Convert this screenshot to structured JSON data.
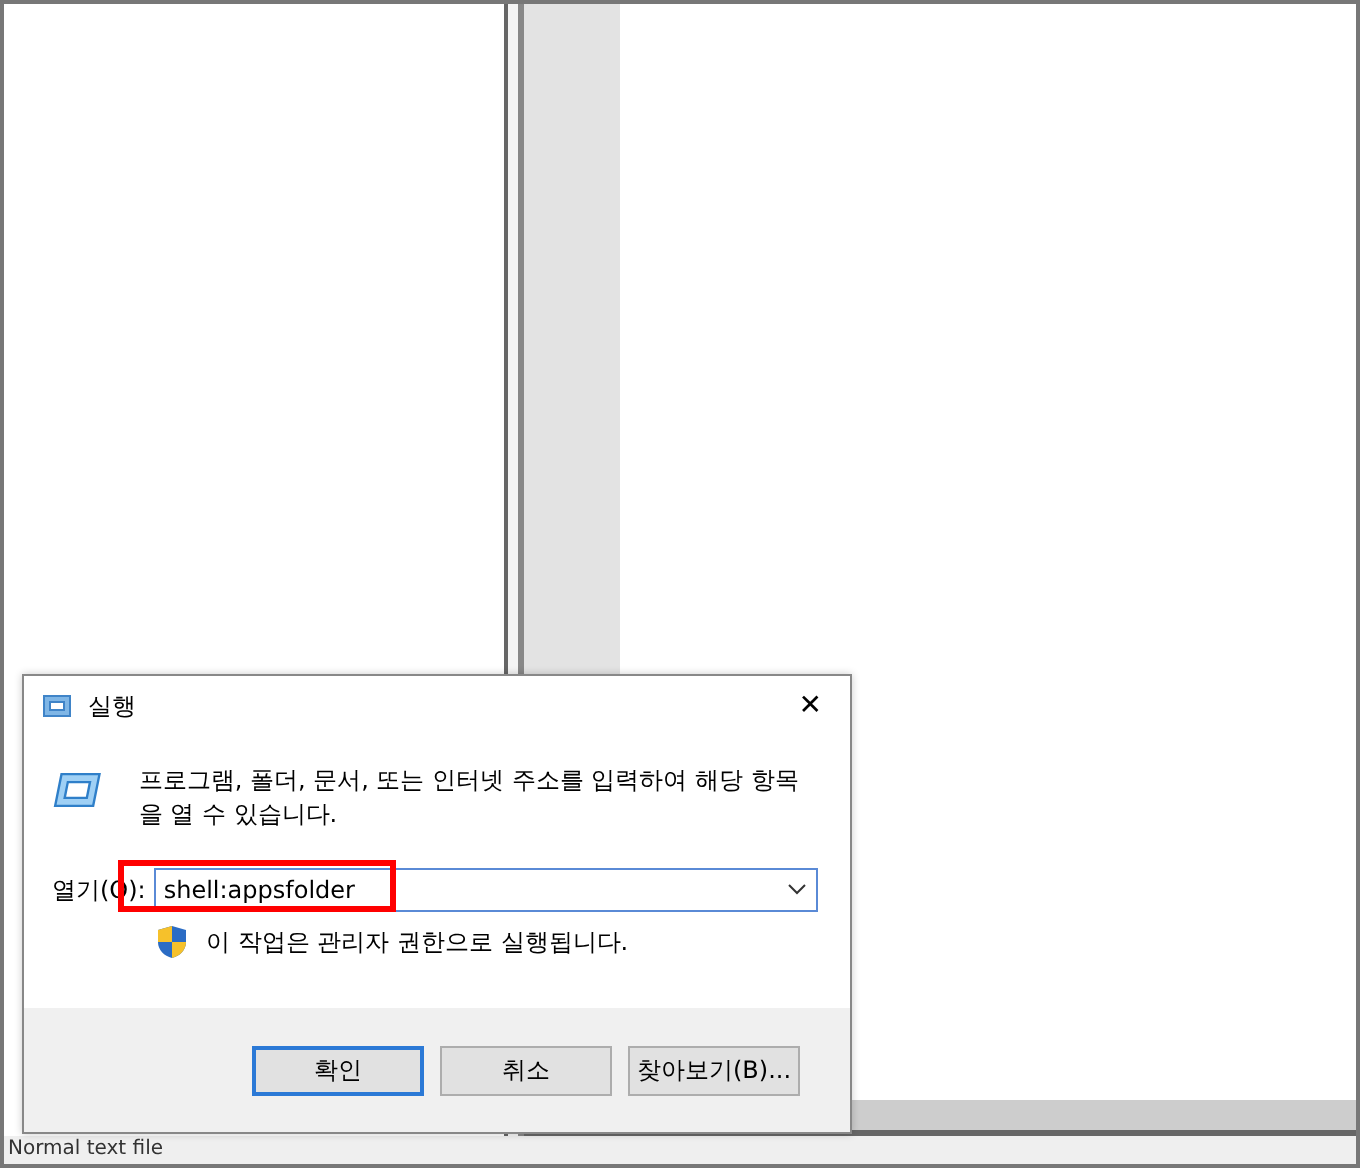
{
  "status_bar": {
    "text": "Normal text file"
  },
  "dialog": {
    "title": "실행",
    "close": "✕",
    "description": "프로그램, 폴더, 문서, 또는 인터넷 주소를 입력하여 해당 항목을 열 수 있습니다.",
    "open_label": "열기(O):",
    "open_value": "shell:appsfolder",
    "admin_note": "이 작업은 관리자 권한으로 실행됩니다.",
    "highlighted": true,
    "buttons": [
      {
        "label": "확인",
        "selected": true
      },
      {
        "label": "취소",
        "selected": false
      },
      {
        "label": "찾아보기(B)...",
        "selected": false
      }
    ]
  }
}
